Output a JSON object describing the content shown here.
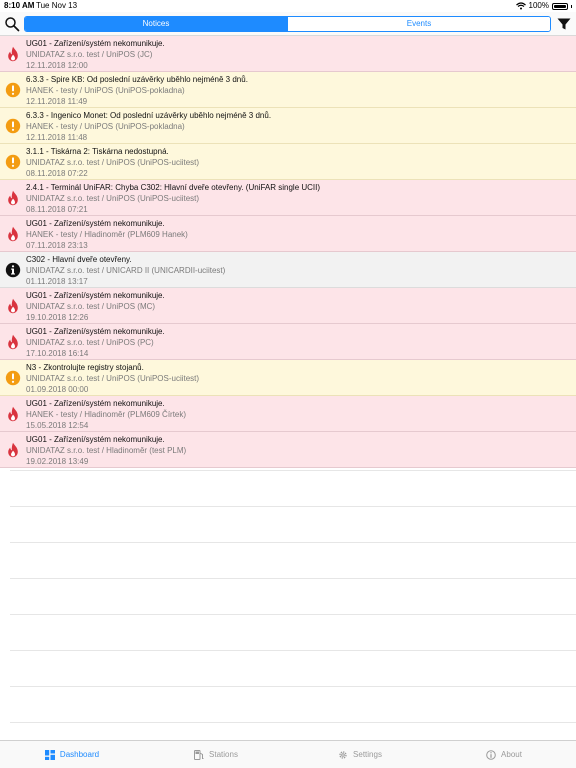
{
  "status_bar": {
    "time": "8:10 AM",
    "date": "Tue Nov 13",
    "battery": "100%"
  },
  "toolbar": {
    "tabs": [
      {
        "label": "Notices",
        "active": true
      },
      {
        "label": "Events",
        "active": false
      }
    ]
  },
  "notices": [
    {
      "severity": "critical",
      "icon": "flame-icon",
      "title": "UG01 - Zařízení/systém nekomunikuje.",
      "subtitle": "UNIDATAZ s.r.o. test / UniPOS (JC)",
      "date": "12.11.2018 12:00"
    },
    {
      "severity": "warning",
      "icon": "exclamation-icon",
      "title": "6.3.3 - Spire KB: Od poslední uzávěrky uběhlo nejméně 3 dnů.",
      "subtitle": "HANEK - testy / UniPOS (UniPOS-pokladna)",
      "date": "12.11.2018 11:49"
    },
    {
      "severity": "warning",
      "icon": "exclamation-icon",
      "title": "6.3.3 - Ingenico Monet: Od poslední uzávěrky uběhlo nejméně 3 dnů.",
      "subtitle": "HANEK - testy / UniPOS (UniPOS-pokladna)",
      "date": "12.11.2018 11:48"
    },
    {
      "severity": "warning",
      "icon": "exclamation-icon",
      "title": "3.1.1 - Tiskárna 2: Tiskárna nedostupná.",
      "subtitle": "UNIDATAZ s.r.o. test / UniPOS (UniPOS-uciitest)",
      "date": "08.11.2018 07:22"
    },
    {
      "severity": "critical",
      "icon": "flame-icon",
      "title": "2.4.1 - Terminál UniFAR: Chyba C302: Hlavní dveře otevřeny. (UniFAR single UCII)",
      "subtitle": "UNIDATAZ s.r.o. test / UniPOS (UniPOS-uciitest)",
      "date": "08.11.2018 07:21"
    },
    {
      "severity": "critical",
      "icon": "flame-icon",
      "title": "UG01 - Zařízení/systém nekomunikuje.",
      "subtitle": "HANEK - testy / Hladinoměr (PLM609 Hanek)",
      "date": "07.11.2018 23:13"
    },
    {
      "severity": "info",
      "icon": "info-icon",
      "title": "C302 - Hlavní dveře otevřeny.",
      "subtitle": "UNIDATAZ s.r.o. test / UNICARD II (UNICARDII-uciitest)",
      "date": "01.11.2018 13:17"
    },
    {
      "severity": "critical",
      "icon": "flame-icon",
      "title": "UG01 - Zařízení/systém nekomunikuje.",
      "subtitle": "UNIDATAZ s.r.o. test / UniPOS (MC)",
      "date": "19.10.2018 12:26"
    },
    {
      "severity": "critical",
      "icon": "flame-icon",
      "title": "UG01 - Zařízení/systém nekomunikuje.",
      "subtitle": "UNIDATAZ s.r.o. test / UniPOS (PC)",
      "date": "17.10.2018 16:14"
    },
    {
      "severity": "warning",
      "icon": "exclamation-icon",
      "title": "N3 - Zkontrolujte registry stojanů.",
      "subtitle": "UNIDATAZ s.r.o. test / UniPOS (UniPOS-uciitest)",
      "date": "01.09.2018 00:00"
    },
    {
      "severity": "critical",
      "icon": "flame-icon",
      "title": "UG01 - Zařízení/systém nekomunikuje.",
      "subtitle": "HANEK - testy / Hladinoměr (PLM609 Čírtek)",
      "date": "15.05.2018 12:54"
    },
    {
      "severity": "critical",
      "icon": "flame-icon",
      "title": "UG01 - Zařízení/systém nekomunikuje.",
      "subtitle": "UNIDATAZ s.r.o. test / Hladinoměr (test PLM)",
      "date": "19.02.2018 13:49"
    }
  ],
  "tab_bar": [
    {
      "label": "Dashboard",
      "icon": "dashboard-icon",
      "active": true
    },
    {
      "label": "Stations",
      "icon": "fuel-pump-icon",
      "active": false
    },
    {
      "label": "Settings",
      "icon": "gear-icon",
      "active": false
    },
    {
      "label": "About",
      "icon": "info-circle-icon",
      "active": false
    }
  ],
  "colors": {
    "accent": "#1e8bff",
    "critical_bg": "#fde4e8",
    "warning_bg": "#fef8dc",
    "info_bg": "#f2f2f2",
    "flame": "#d9343f",
    "warning": "#f39c12"
  }
}
